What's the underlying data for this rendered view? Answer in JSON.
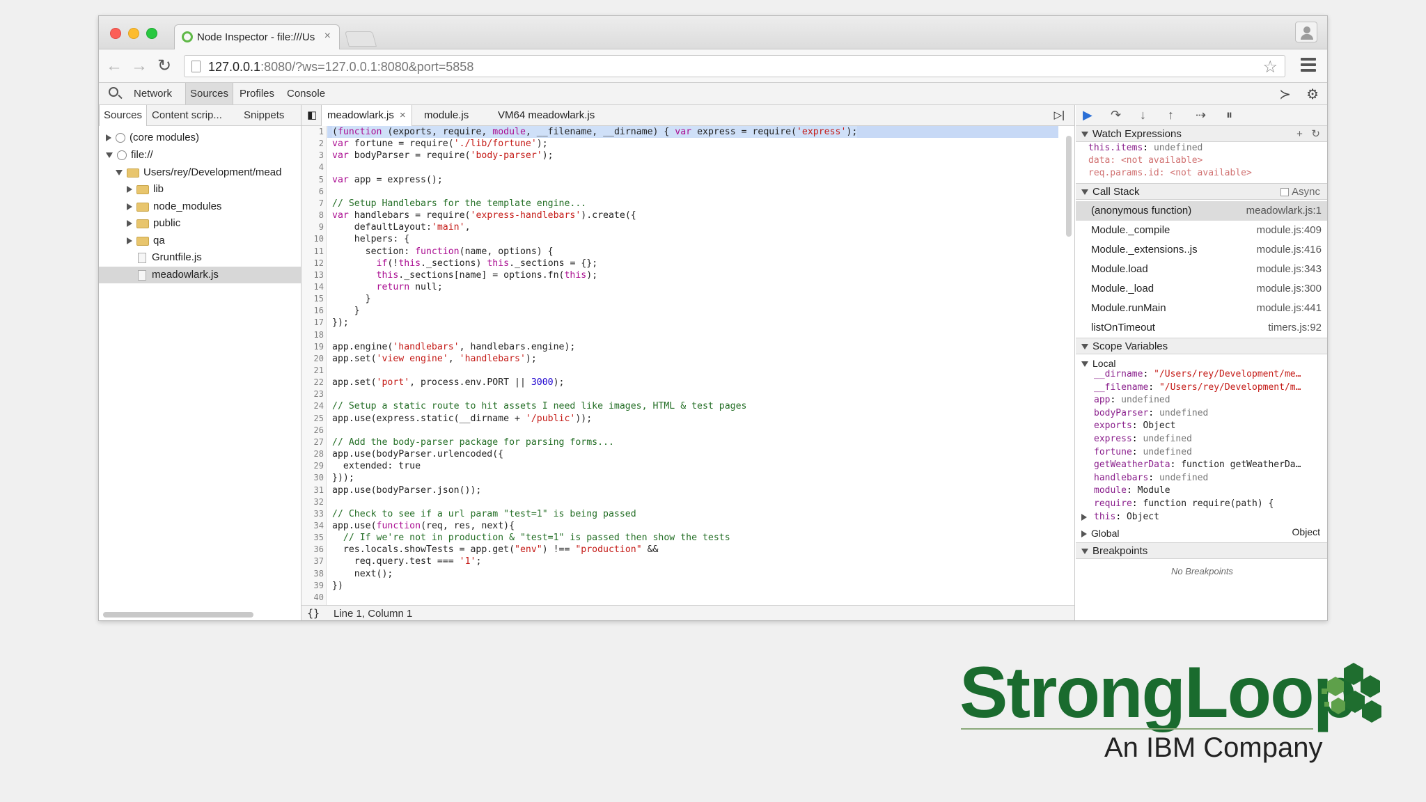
{
  "browser": {
    "tab_title": "Node Inspector - file:///Us",
    "url_host": "127.0.0.1",
    "url_rest": ":8080/?ws=127.0.0.1:8080&port=5858"
  },
  "devtools": {
    "tabs": [
      "Network",
      "Sources",
      "Profiles",
      "Console"
    ],
    "active_tab": "Sources"
  },
  "navigator": {
    "tabs": [
      "Sources",
      "Content scrip...",
      "Snippets"
    ],
    "tree": [
      {
        "label": "(core modules)"
      },
      {
        "label": "file://"
      },
      {
        "label": "Users/rey/Development/mead"
      },
      {
        "label": "lib"
      },
      {
        "label": "node_modules"
      },
      {
        "label": "public"
      },
      {
        "label": "qa"
      },
      {
        "label": "Gruntfile.js"
      },
      {
        "label": "meadowlark.js"
      }
    ]
  },
  "editor": {
    "tabs": [
      "meadowlark.js",
      "module.js",
      "VM64 meadowlark.js"
    ],
    "status": "Line 1, Column 1",
    "format_icon": "{}",
    "lines": [
      "(function (exports, require, module, __filename, __dirname) { var express = require('express');",
      "var fortune = require('./lib/fortune');",
      "var bodyParser = require('body-parser');",
      "",
      "var app = express();",
      "",
      "// Setup Handlebars for the template engine...",
      "var handlebars = require('express-handlebars').create({",
      "    defaultLayout:'main',",
      "    helpers: {",
      "      section: function(name, options) {",
      "        if(!this._sections) this._sections = {};",
      "        this._sections[name] = options.fn(this);",
      "        return null;",
      "      }",
      "    }",
      "});",
      "",
      "app.engine('handlebars', handlebars.engine);",
      "app.set('view engine', 'handlebars');",
      "",
      "app.set('port', process.env.PORT || 3000);",
      "",
      "// Setup a static route to hit assets I need like images, HTML & test pages",
      "app.use(express.static(__dirname + '/public'));",
      "",
      "// Add the body-parser package for parsing forms...",
      "app.use(bodyParser.urlencoded({",
      "  extended: true",
      "}));",
      "app.use(bodyParser.json());",
      "",
      "// Check to see if a url param \"test=1\" is being passed",
      "app.use(function(req, res, next){",
      "  // If we're not in production & \"test=1\" is passed then show the tests",
      "  res.locals.showTests = app.get(\"env\") !== \"production\" &&",
      "    req.query.test === '1';",
      "    next();",
      "})",
      "",
      "// mocked weather data"
    ]
  },
  "debugger": {
    "watch_title": "Watch Expressions",
    "watches": [
      {
        "expr": "this.items",
        "value": "undefined"
      },
      {
        "expr": "data",
        "value": "<not available>"
      },
      {
        "expr": "req.params.id",
        "value": "<not available>"
      }
    ],
    "callstack_title": "Call Stack",
    "async_label": "Async",
    "callstack": [
      {
        "fn": "(anonymous function)",
        "loc": "meadowlark.js:1"
      },
      {
        "fn": "Module._compile",
        "loc": "module.js:409"
      },
      {
        "fn": "Module._extensions..js",
        "loc": "module.js:416"
      },
      {
        "fn": "Module.load",
        "loc": "module.js:343"
      },
      {
        "fn": "Module._load",
        "loc": "module.js:300"
      },
      {
        "fn": "Module.runMain",
        "loc": "module.js:441"
      },
      {
        "fn": "listOnTimeout",
        "loc": "timers.js:92"
      }
    ],
    "scope_title": "Scope Variables",
    "local_label": "Local",
    "scope": [
      {
        "name": "__dirname",
        "value": "\"/Users/rey/Development/me…",
        "kind": "str",
        "expandable": false
      },
      {
        "name": "__filename",
        "value": "\"/Users/rey/Development/m…",
        "kind": "str",
        "expandable": false
      },
      {
        "name": "app",
        "value": "undefined",
        "kind": "u",
        "expandable": false
      },
      {
        "name": "bodyParser",
        "value": "undefined",
        "kind": "u",
        "expandable": false
      },
      {
        "name": "exports",
        "value": "Object",
        "kind": "obj",
        "expandable": true
      },
      {
        "name": "express",
        "value": "undefined",
        "kind": "u",
        "expandable": false
      },
      {
        "name": "fortune",
        "value": "undefined",
        "kind": "u",
        "expandable": false
      },
      {
        "name": "getWeatherData",
        "value": "function getWeatherDa…",
        "kind": "obj",
        "expandable": true
      },
      {
        "name": "handlebars",
        "value": "undefined",
        "kind": "u",
        "expandable": false
      },
      {
        "name": "module",
        "value": "Module",
        "kind": "obj",
        "expandable": true
      },
      {
        "name": "require",
        "value": "function require(path) {",
        "kind": "obj",
        "expandable": true
      },
      {
        "name": "this",
        "value": "Object",
        "kind": "obj",
        "expandable": true
      }
    ],
    "global_label": "Global",
    "global_value": "Object",
    "breakpoints_title": "Breakpoints",
    "no_breakpoints": "No Breakpoints"
  },
  "logo": {
    "brand": "StrongLoop",
    "tagline": "An IBM Company",
    "brand_color": "#1a6b2e"
  }
}
